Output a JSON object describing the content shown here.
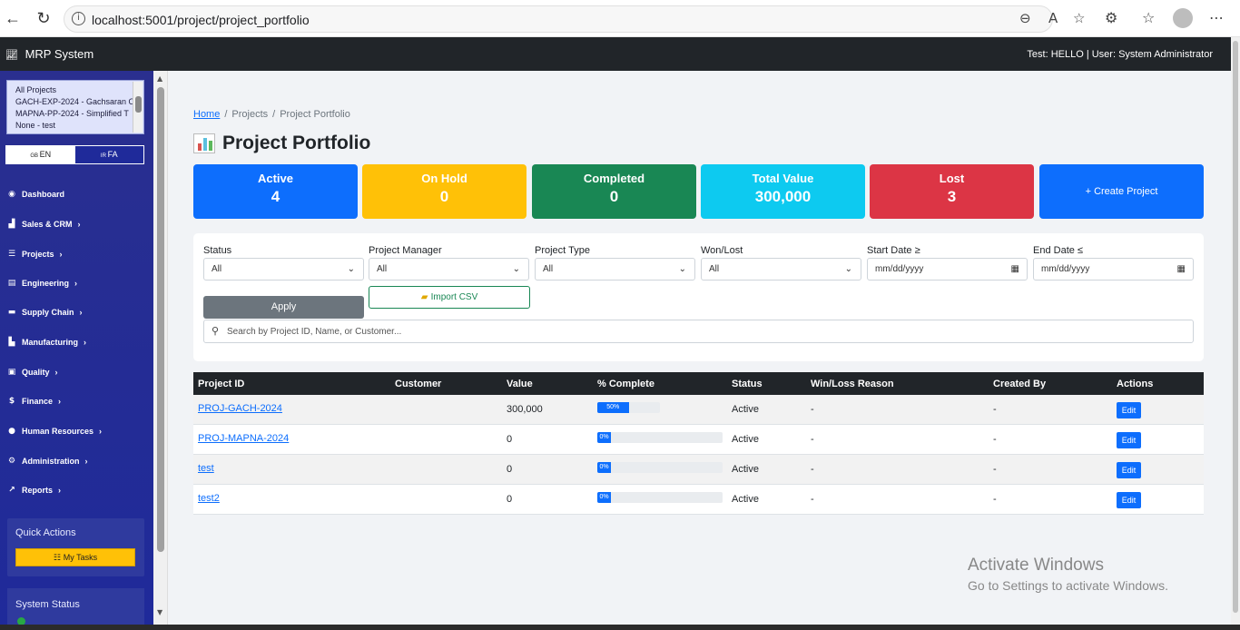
{
  "browser": {
    "url": "localhost:5001/project/project_portfolio"
  },
  "app": {
    "brand": "MRP System",
    "user_info": "Test: HELLO | User: System Administrator"
  },
  "sidebar": {
    "project_options": [
      "All Projects",
      "GACH-EXP-2024 - Gachsaran O",
      "MAPNA-PP-2024 - Simplified T",
      "None - test"
    ],
    "lang_en": "EN",
    "lang_fa": "FA",
    "nav": [
      {
        "label": "Dashboard",
        "icon": "dashboard-icon"
      },
      {
        "label": "Sales & CRM",
        "icon": "chart-icon"
      },
      {
        "label": "Projects",
        "icon": "list-icon"
      },
      {
        "label": "Engineering",
        "icon": "document-icon"
      },
      {
        "label": "Supply Chain",
        "icon": "truck-icon"
      },
      {
        "label": "Manufacturing",
        "icon": "factory-icon"
      },
      {
        "label": "Quality",
        "icon": "clipboard-icon"
      },
      {
        "label": "Finance",
        "icon": "dollar-icon"
      },
      {
        "label": "Human Resources",
        "icon": "people-icon"
      },
      {
        "label": "Administration",
        "icon": "gear-icon"
      },
      {
        "label": "Reports",
        "icon": "chart-line-icon"
      }
    ],
    "quick_actions_title": "Quick Actions",
    "my_tasks_label": "My Tasks",
    "system_status_title": "System Status"
  },
  "breadcrumb": {
    "home": "Home",
    "projects": "Projects",
    "current": "Project Portfolio"
  },
  "page_title": "Project Portfolio",
  "stats": [
    {
      "label": "Active",
      "value": "4",
      "color": "#0d6efd"
    },
    {
      "label": "On Hold",
      "value": "0",
      "color": "#ffc107"
    },
    {
      "label": "Completed",
      "value": "0",
      "color": "#198754"
    },
    {
      "label": "Total Value",
      "value": "300,000",
      "color": "#0dcaf0"
    },
    {
      "label": "Lost",
      "value": "3",
      "color": "#dc3545"
    }
  ],
  "create_label": "+ Create Project",
  "filters": {
    "status_label": "Status",
    "status_value": "All",
    "manager_label": "Project Manager",
    "manager_value": "All",
    "type_label": "Project Type",
    "type_value": "All",
    "wonlost_label": "Won/Lost",
    "wonlost_value": "All",
    "start_label": "Start Date ≥",
    "start_placeholder": "mm/dd/yyyy",
    "end_label": "End Date ≤",
    "end_placeholder": "mm/dd/yyyy",
    "apply_label": "Apply",
    "import_label": "Import CSV",
    "search_placeholder": "Search by Project ID, Name, or Customer..."
  },
  "table": {
    "columns": [
      "Project ID",
      "Customer",
      "Value",
      "% Complete",
      "Status",
      "Win/Loss Reason",
      "Created By",
      "Actions"
    ],
    "rows": [
      {
        "id": "PROJ-GACH-2024",
        "customer": "",
        "value": "300,000",
        "pct": 50,
        "pct_label": "50%",
        "status": "Active",
        "reason": "-",
        "created_by": "-",
        "action": "Edit"
      },
      {
        "id": "PROJ-MAPNA-2024",
        "customer": "",
        "value": "0",
        "pct": 0,
        "pct_label": "0%",
        "status": "Active",
        "reason": "-",
        "created_by": "-",
        "action": "Edit"
      },
      {
        "id": "test",
        "customer": "",
        "value": "0",
        "pct": 0,
        "pct_label": "0%",
        "status": "Active",
        "reason": "-",
        "created_by": "-",
        "action": "Edit"
      },
      {
        "id": "test2",
        "customer": "",
        "value": "0",
        "pct": 0,
        "pct_label": "0%",
        "status": "Active",
        "reason": "-",
        "created_by": "-",
        "action": "Edit"
      }
    ]
  },
  "watermark": {
    "line1": "Activate Windows",
    "line2": "Go to Settings to activate Windows."
  }
}
